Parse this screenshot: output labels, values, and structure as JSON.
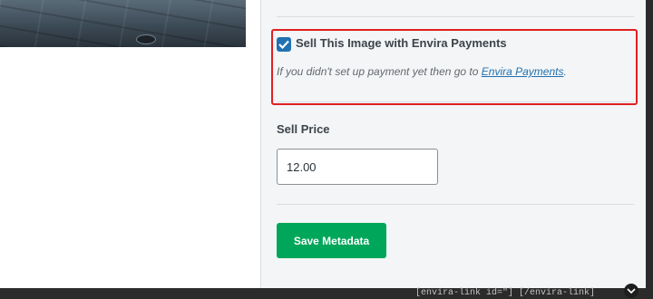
{
  "preview": {
    "icon": "image-preview"
  },
  "sell_section": {
    "checkbox_checked": true,
    "label": "Sell This Image with Envira Payments",
    "help_prefix": "If you didn't set up payment yet then go to ",
    "help_link": "Envira Payments",
    "help_suffix": "."
  },
  "price": {
    "label": "Sell Price",
    "value": "12.00"
  },
  "actions": {
    "save_label": "Save Metadata"
  },
  "underlying": {
    "text": "[envira-link id=\"] [/envira-link]"
  },
  "colors": {
    "accent": "#2271b1",
    "highlight_border": "#e02020",
    "save_button": "#00a65a",
    "panel_bg": "#f3f5f6"
  }
}
